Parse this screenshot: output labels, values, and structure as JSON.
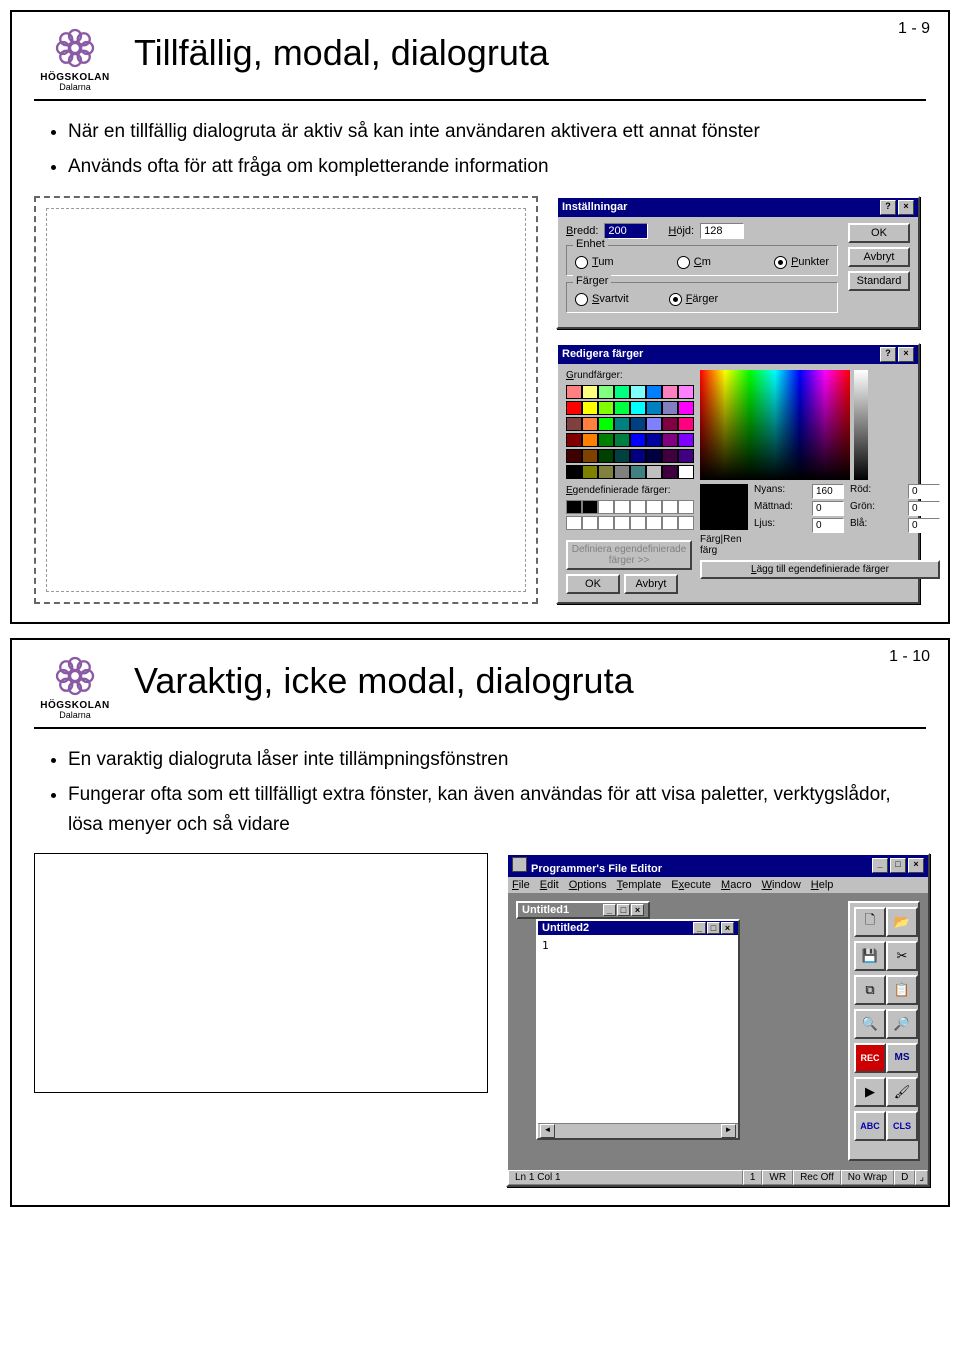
{
  "branding": {
    "line1": "HÖGSKOLAN",
    "line2": "Dalarna"
  },
  "slide1": {
    "page": "1 - 9",
    "title": "Tillfällig, modal, dialogruta",
    "bullets": [
      "När en tillfällig dialogruta är aktiv så kan inte användaren aktivera ett annat fönster",
      "Används ofta för att fråga om kompletterande information"
    ],
    "dialog_settings": {
      "title": "Inställningar",
      "bredd_label": "Bredd:",
      "bredd_value": "200",
      "hojd_label": "Höjd:",
      "hojd_value": "128",
      "group_enhet": "Enhet",
      "opt_tum": "Tum",
      "opt_cm": "Cm",
      "opt_punkter": "Punkter",
      "group_farger": "Färger",
      "opt_svartvit": "Svartvit",
      "opt_farger": "Färger",
      "btn_ok": "OK",
      "btn_avbryt": "Avbryt",
      "btn_standard": "Standard"
    },
    "dialog_colors": {
      "title": "Redigera färger",
      "grundfarger_label": "Grundfärger:",
      "egendef_label": "Egendefinierade färger:",
      "btn_define": "Definiera egendefinierade färger >>",
      "btn_ok": "OK",
      "btn_avbryt": "Avbryt",
      "btn_add": "Lägg till egendefinierade färger",
      "solid_label": "Färg|Ren färg",
      "nyans": "Nyans:",
      "nyans_v": "160",
      "mattnad": "Mättnad:",
      "mattnad_v": "0",
      "ljus": "Ljus:",
      "ljus_v": "0",
      "rod": "Röd:",
      "rod_v": "0",
      "gron": "Grön:",
      "gron_v": "0",
      "bla": "Blå:",
      "bla_v": "0"
    }
  },
  "slide2": {
    "page": "1 - 10",
    "title": "Varaktig, icke modal, dialogruta",
    "bullets": [
      "En varaktig dialogruta låser inte tillämpningsfönstren",
      "Fungerar ofta som ett tillfälligt extra fönster, kan även användas för att visa paletter, verktygslådor, lösa menyer och så vidare"
    ],
    "editor": {
      "app_title": "Programmer's File Editor",
      "menus": [
        "File",
        "Edit",
        "Options",
        "Template",
        "Execute",
        "Macro",
        "Window",
        "Help"
      ],
      "doc1": "Untitled1",
      "doc2": "Untitled2",
      "doc2_content": "1",
      "status": {
        "pos": "Ln 1 Col 1",
        "num": "1",
        "mode": "WR",
        "rec": "Rec Off",
        "wrap": "No Wrap",
        "flag": "D"
      },
      "tool_icons": [
        "new-file-icon",
        "open-folder-icon",
        "save-icon",
        "cut-icon",
        "copy-icon",
        "paste-icon",
        "search-icon",
        "search-scope-icon",
        "record-icon",
        "ms-icon",
        "play-icon",
        "brush-icon",
        "abc-icon",
        "cls-icon"
      ]
    }
  },
  "swatch_colors": [
    "#ff8080",
    "#ffff80",
    "#80ff80",
    "#00ff80",
    "#80ffff",
    "#0080ff",
    "#ff80c0",
    "#ff80ff",
    "#ff0000",
    "#ffff00",
    "#80ff00",
    "#00ff40",
    "#00ffff",
    "#0080c0",
    "#8080c0",
    "#ff00ff",
    "#804040",
    "#ff8040",
    "#00ff00",
    "#008080",
    "#004080",
    "#8080ff",
    "#800040",
    "#ff0080",
    "#800000",
    "#ff8000",
    "#008000",
    "#008040",
    "#0000ff",
    "#0000a0",
    "#800080",
    "#8000ff",
    "#400000",
    "#804000",
    "#004000",
    "#004040",
    "#000080",
    "#000040",
    "#400040",
    "#400080",
    "#000000",
    "#808000",
    "#808040",
    "#808080",
    "#408080",
    "#c0c0c0",
    "#400040",
    "#ffffff"
  ]
}
